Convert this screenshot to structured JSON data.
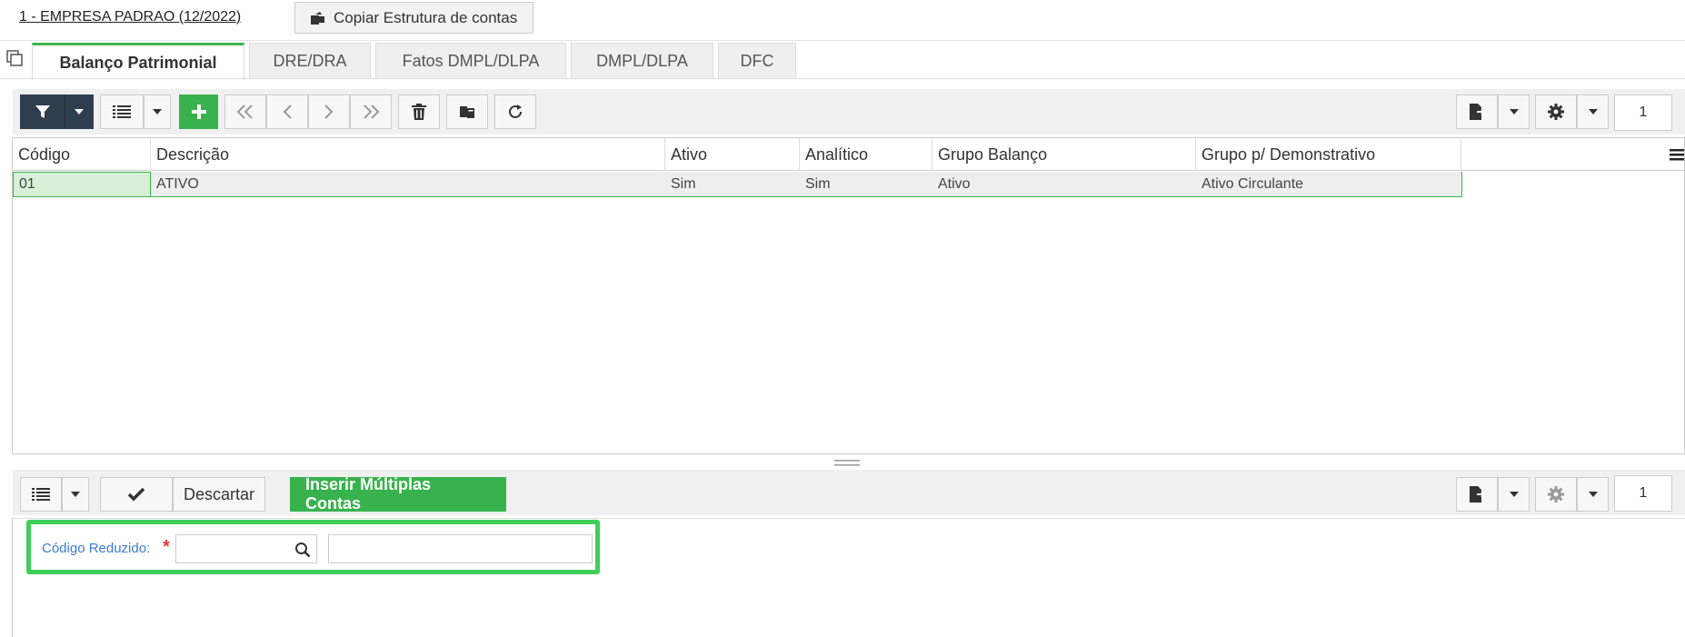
{
  "header": {
    "company": "1 - EMPRESA PADRAO (12/2022)",
    "copy_button": "Copiar Estrutura de contas"
  },
  "tabs": [
    {
      "label": "Balanço Patrimonial",
      "active": true
    },
    {
      "label": "DRE/DRA"
    },
    {
      "label": "Fatos DMPL/DLPA"
    },
    {
      "label": "DMPL/DLPA"
    },
    {
      "label": "DFC"
    }
  ],
  "toolbar": {
    "page_number": "1",
    "icons": [
      "filter-icon",
      "caret-down-icon",
      "list-icon",
      "plus-icon",
      "first-page-icon",
      "prev-page-icon",
      "next-page-icon",
      "last-page-icon",
      "trash-icon",
      "copy-icon",
      "refresh-icon",
      "export-icon",
      "gear-icon"
    ]
  },
  "grid": {
    "columns": [
      "Código",
      "Descrição",
      "Ativo",
      "Analítico",
      "Grupo Balanço",
      "Grupo p/ Demonstrativo"
    ],
    "rows": [
      [
        "01",
        "ATIVO",
        "Sim",
        "Sim",
        "Ativo",
        "Ativo Circulante"
      ]
    ]
  },
  "toolbar2": {
    "discard": "Descartar",
    "insert_multiple": "Inserir Múltiplas Contas",
    "page_number": "1"
  },
  "form": {
    "field_label": "Código Reduzido:",
    "required_mark": "*"
  },
  "colors": {
    "accent_green": "#37b24d",
    "dark_button": "#2f3e4e",
    "label_blue": "#3a7bd5"
  }
}
